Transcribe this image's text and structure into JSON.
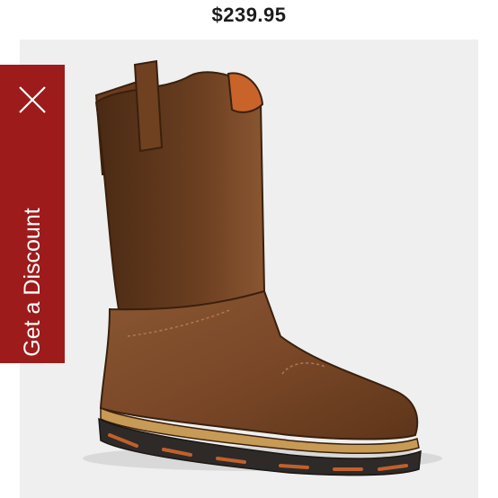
{
  "product": {
    "price": "$239.95",
    "image_alt": "Brown leather pull-on work boot"
  },
  "discount_tab": {
    "label": "Get a Discount",
    "close_icon": "close-icon",
    "background_color": "#9e1b1b"
  },
  "colors": {
    "panel_background": "#efefef",
    "boot_leather": "#7a4a2a",
    "price_text": "#1c1c1c"
  }
}
